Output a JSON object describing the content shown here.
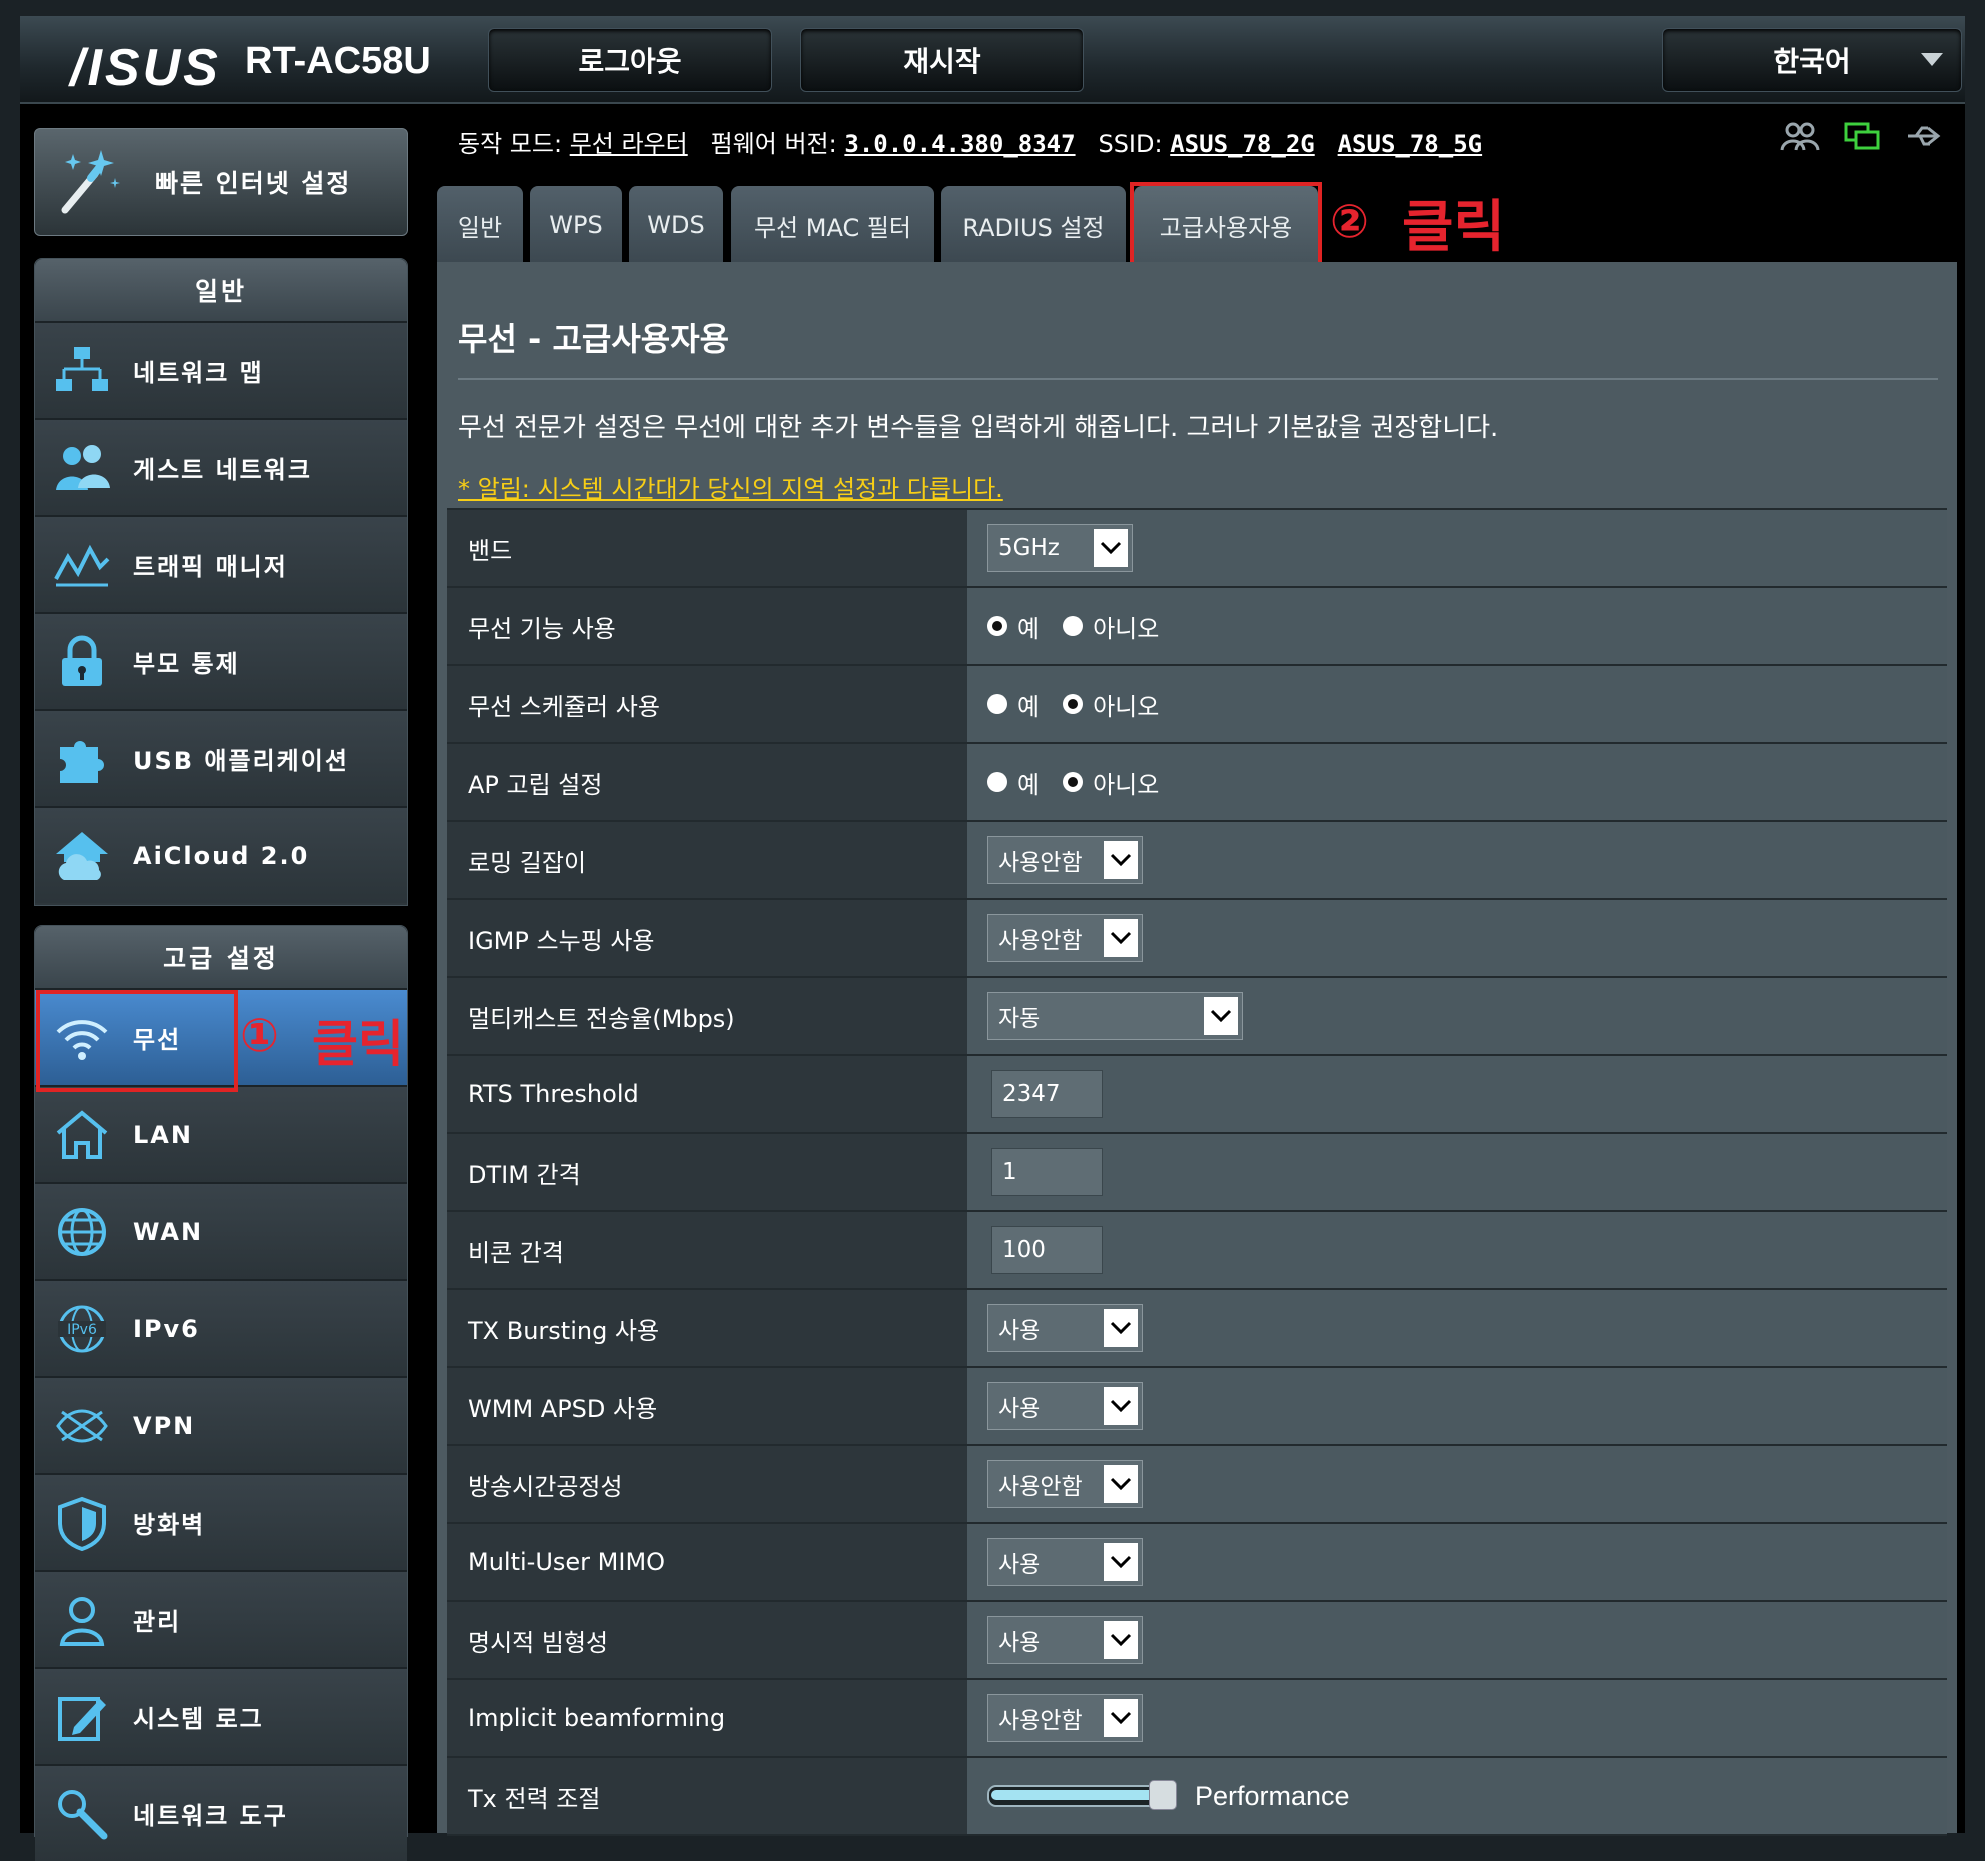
{
  "header": {
    "logo": "/ISUS",
    "model": "RT-AC58U",
    "logout_label": "로그아웃",
    "reboot_label": "재시작",
    "language": "한국어"
  },
  "sidebar": {
    "quick_setup": "빠른 인터넷 설정",
    "general_title": "일반",
    "general_items": [
      {
        "label": "네트워크 맵",
        "icon": "network-map-icon"
      },
      {
        "label": "게스트 네트워크",
        "icon": "guest-network-icon"
      },
      {
        "label": "트래픽 매니저",
        "icon": "traffic-manager-icon"
      },
      {
        "label": "부모 통제",
        "icon": "lock-icon"
      },
      {
        "label": "USB 애플리케이션",
        "icon": "puzzle-icon"
      },
      {
        "label": "AiCloud 2.0",
        "icon": "cloud-home-icon"
      }
    ],
    "advanced_title": "고급 설정",
    "advanced_items": [
      {
        "label": "무선",
        "icon": "wifi-icon"
      },
      {
        "label": "LAN",
        "icon": "home-icon"
      },
      {
        "label": "WAN",
        "icon": "globe-icon"
      },
      {
        "label": "IPv6",
        "icon": "ipv6-icon"
      },
      {
        "label": "VPN",
        "icon": "vpn-icon"
      },
      {
        "label": "방화벽",
        "icon": "shield-icon"
      },
      {
        "label": "관리",
        "icon": "user-icon"
      },
      {
        "label": "시스템 로그",
        "icon": "edit-icon"
      },
      {
        "label": "네트워크 도구",
        "icon": "tools-icon"
      }
    ]
  },
  "annotations": {
    "step1_num": "①",
    "step1_text": "클릭",
    "step2_num": "②",
    "step2_text": "클릭",
    "color": "#e02424"
  },
  "status": {
    "mode_label": "동작 모드:",
    "mode_value": "무선 라우터",
    "firmware_label": "펌웨어 버전:",
    "firmware_value": "3.0.0.4.380_8347",
    "ssid_label": "SSID:",
    "ssid_2g": "ASUS_78_2G",
    "ssid_5g": "ASUS_78_5G"
  },
  "tabs": [
    "일반",
    "WPS",
    "WDS",
    "무선 MAC 필터",
    "RADIUS 설정",
    "고급사용자용"
  ],
  "page": {
    "title": "무선 - 고급사용자용",
    "description": "무선 전문가 설정은 무선에 대한 추가 변수들을 입력하게 해줍니다. 그러나 기본값을 권장합니다.",
    "notice": "* 알림: 시스템 시간대가 당신의 지역 설정과 다릅니다."
  },
  "radio_labels": {
    "yes": "예",
    "no": "아니오"
  },
  "form": {
    "band": {
      "label": "밴드",
      "value": "5GHz"
    },
    "wireless_enable": {
      "label": "무선 기능 사용",
      "value": "yes"
    },
    "wireless_scheduler": {
      "label": "무선 스케쥴러 사용",
      "value": "no"
    },
    "ap_isolated": {
      "label": "AP 고립 설정",
      "value": "no"
    },
    "roaming_assistant": {
      "label": "로밍 길잡이",
      "value": "사용안함"
    },
    "igmp_snooping": {
      "label": "IGMP 스누핑 사용",
      "value": "사용안함"
    },
    "multicast_rate": {
      "label": "멀티캐스트 전송율(Mbps)",
      "value": "자동"
    },
    "rts_threshold": {
      "label": "RTS Threshold",
      "value": "2347"
    },
    "dtim": {
      "label": "DTIM 간격",
      "value": "1"
    },
    "beacon": {
      "label": "비콘 간격",
      "value": "100"
    },
    "tx_bursting": {
      "label": "TX Bursting 사용",
      "value": "사용"
    },
    "wmm_apsd": {
      "label": "WMM APSD 사용",
      "value": "사용"
    },
    "airtime_fairness": {
      "label": "방송시간공정성",
      "value": "사용안함"
    },
    "mu_mimo": {
      "label": "Multi-User MIMO",
      "value": "사용"
    },
    "explicit_bf": {
      "label": "명시적 빔형성",
      "value": "사용"
    },
    "implicit_bf": {
      "label": "Implicit beamforming",
      "value": "사용안함"
    },
    "tx_power": {
      "label": "Tx 전력 조절",
      "value": "Performance",
      "level": 1.0
    }
  }
}
